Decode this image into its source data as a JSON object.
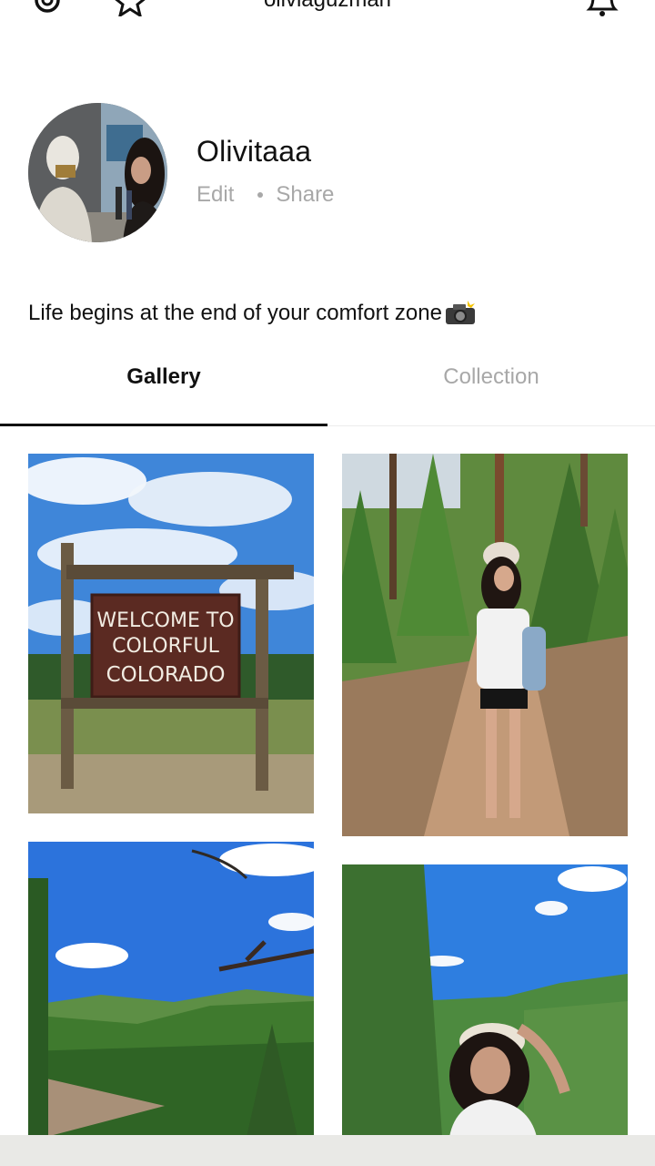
{
  "header": {
    "username": "oliviaguzman",
    "settings_icon": "gear-icon",
    "favorites_icon": "star-icon",
    "notifications_icon": "bell-icon"
  },
  "profile": {
    "display_name": "Olivitaaa",
    "edit_label": "Edit",
    "share_label": "Share",
    "bio": "Life begins at the end of your comfort zone"
  },
  "tabs": [
    {
      "label": "Gallery",
      "active": true
    },
    {
      "label": "Collection",
      "active": false
    }
  ],
  "gallery": {
    "photos": [
      {
        "subject": "colorado-welcome-sign",
        "sign_lines": [
          "WELCOME TO",
          "COLORFUL",
          "COLORADO"
        ]
      },
      {
        "subject": "forest-trail-hiker"
      },
      {
        "subject": "mountain-valley"
      },
      {
        "subject": "valley-selfie"
      }
    ]
  },
  "colors": {
    "text": "#111111",
    "muted": "#a8a8a8",
    "sky": "#3f86d9",
    "forest": "#3f7a2e"
  }
}
